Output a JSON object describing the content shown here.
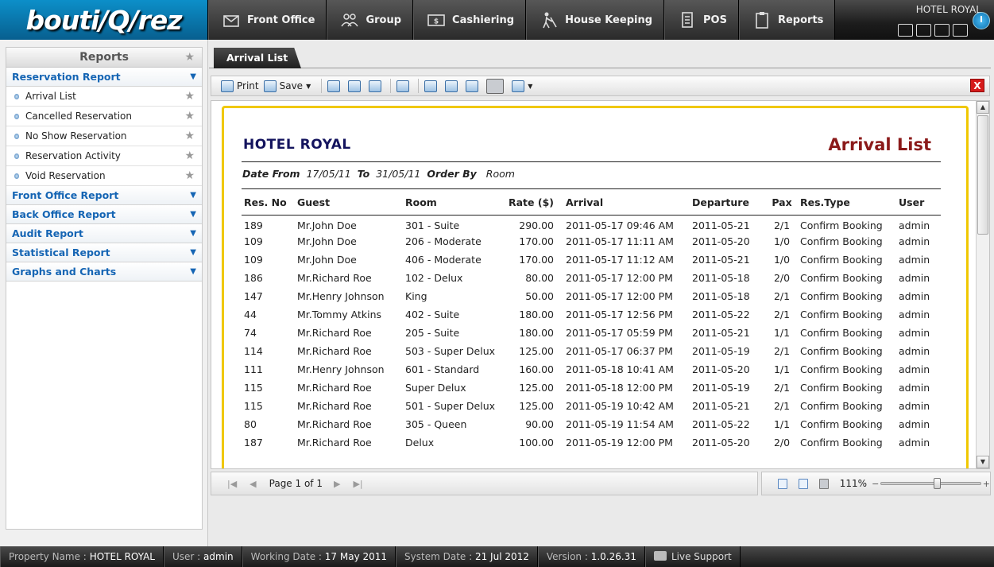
{
  "app": {
    "logo": "bouti/Q/rez",
    "hotel_name": "HOTEL ROYAL"
  },
  "nav": [
    {
      "label": "Front Office",
      "icon": "front-office-icon"
    },
    {
      "label": "Group",
      "icon": "group-icon"
    },
    {
      "label": "Cashiering",
      "icon": "cashiering-icon"
    },
    {
      "label": "House Keeping",
      "icon": "housekeeping-icon"
    },
    {
      "label": "POS",
      "icon": "pos-icon"
    },
    {
      "label": "Reports",
      "icon": "reports-icon"
    }
  ],
  "sidebar": {
    "title": "Reports",
    "categories": [
      {
        "label": "Reservation Report",
        "items": [
          "Arrival List",
          "Cancelled Reservation",
          "No Show Reservation",
          "Reservation Activity",
          "Void Reservation"
        ]
      },
      {
        "label": "Front Office Report"
      },
      {
        "label": "Back Office Report"
      },
      {
        "label": "Audit Report"
      },
      {
        "label": "Statistical Report"
      },
      {
        "label": "Graphs and Charts"
      }
    ]
  },
  "tab": {
    "label": "Arrival List"
  },
  "toolbar": {
    "print": "Print",
    "save": "Save",
    "close": "X"
  },
  "report": {
    "hotel": "HOTEL ROYAL",
    "title": "Arrival List",
    "date_from_label": "Date From",
    "date_from": "17/05/11",
    "to_label": "To",
    "date_to": "31/05/11",
    "order_by_label": "Order By",
    "order_by": "Room",
    "columns": [
      "Res. No",
      "Guest",
      "Room",
      "Rate ($)",
      "Arrival",
      "Departure",
      "Pax",
      "Res.Type",
      "User"
    ],
    "rows": [
      [
        "189",
        "Mr.John Doe",
        "301 - Suite",
        "290.00",
        "2011-05-17 09:46 AM",
        "2011-05-21",
        "2/1",
        "Confirm Booking",
        "admin"
      ],
      [
        "109",
        "Mr.John Doe",
        "206 - Moderate",
        "170.00",
        "2011-05-17 11:11 AM",
        "2011-05-20",
        "1/0",
        "Confirm Booking",
        "admin"
      ],
      [
        "109",
        "Mr.John Doe",
        "406 - Moderate",
        "170.00",
        "2011-05-17 11:12 AM",
        "2011-05-21",
        "1/0",
        "Confirm Booking",
        "admin"
      ],
      [
        "186",
        "Mr.Richard Roe",
        "102 - Delux",
        "80.00",
        "2011-05-17 12:00 PM",
        "2011-05-18",
        "2/0",
        "Confirm Booking",
        "admin"
      ],
      [
        "147",
        "Mr.Henry Johnson",
        "King",
        "50.00",
        "2011-05-17 12:00 PM",
        "2011-05-18",
        "2/1",
        "Confirm Booking",
        "admin"
      ],
      [
        "44",
        "Mr.Tommy Atkins",
        "402 - Suite",
        "180.00",
        "2011-05-17 12:56 PM",
        "2011-05-22",
        "2/1",
        "Confirm Booking",
        "admin"
      ],
      [
        "74",
        "Mr.Richard Roe",
        "205 - Suite",
        "180.00",
        "2011-05-17 05:59 PM",
        "2011-05-21",
        "1/1",
        "Confirm Booking",
        "admin"
      ],
      [
        "114",
        "Mr.Richard Roe",
        "503 - Super Delux",
        "125.00",
        "2011-05-17 06:37 PM",
        "2011-05-19",
        "2/1",
        "Confirm Booking",
        "admin"
      ],
      [
        "111",
        "Mr.Henry Johnson",
        "601 - Standard",
        "160.00",
        "2011-05-18 10:41 AM",
        "2011-05-20",
        "1/1",
        "Confirm Booking",
        "admin"
      ],
      [
        "115",
        "Mr.Richard Roe",
        "Super Delux",
        "125.00",
        "2011-05-18 12:00 PM",
        "2011-05-19",
        "2/1",
        "Confirm Booking",
        "admin"
      ],
      [
        "115",
        "Mr.Richard Roe",
        "501 - Super Delux",
        "125.00",
        "2011-05-19 10:42 AM",
        "2011-05-21",
        "2/1",
        "Confirm Booking",
        "admin"
      ],
      [
        "80",
        "Mr.Richard Roe",
        "305 - Queen",
        "90.00",
        "2011-05-19 11:54 AM",
        "2011-05-22",
        "1/1",
        "Confirm Booking",
        "admin"
      ],
      [
        "187",
        "Mr.Richard Roe",
        "Delux",
        "100.00",
        "2011-05-19 12:00 PM",
        "2011-05-20",
        "2/0",
        "Confirm Booking",
        "admin"
      ]
    ]
  },
  "pager": {
    "page_info": "Page 1 of 1"
  },
  "zoom": {
    "label": "111%",
    "level": 0.5
  },
  "status": {
    "property_label": "Property Name :",
    "property": "HOTEL ROYAL",
    "user_label": "User :",
    "user": "admin",
    "working_date_label": "Working Date :",
    "working_date": "17 May 2011",
    "system_date_label": "System Date :",
    "system_date": "21 Jul 2012",
    "version_label": "Version :",
    "version": "1.0.26.31",
    "support": "Live Support"
  }
}
